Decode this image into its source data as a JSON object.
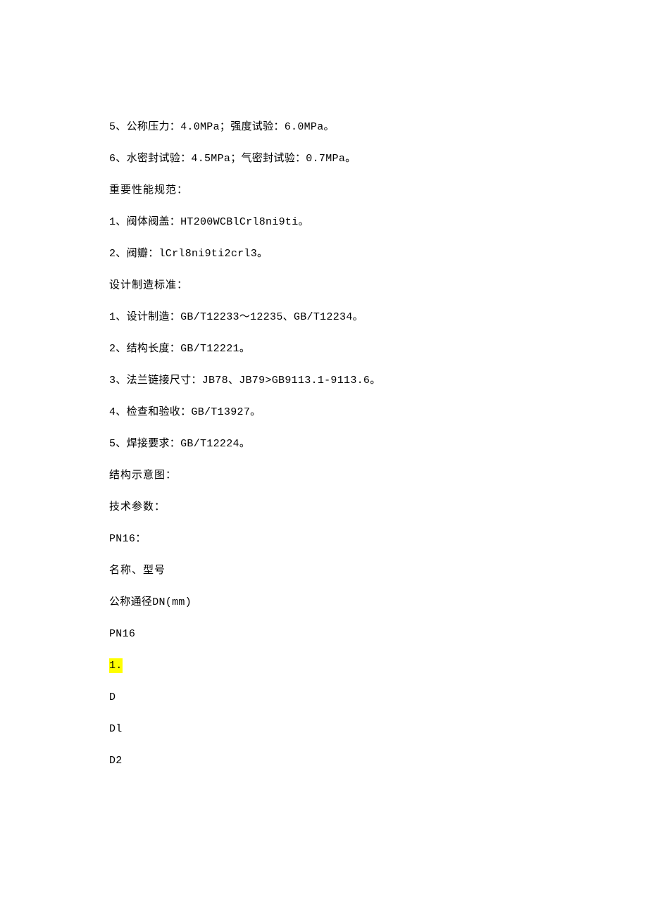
{
  "doc": {
    "l1": "5、公称压力：4.0MPa；强度试验：6.0MPa。",
    "l2": "6、水密封试验：4.5MPa；气密封试验：0.7MPa。",
    "l3": "重要性能规范：",
    "l4": "1、阀体阀盖：HT200WCBlCrl8ni9ti。",
    "l5": "2、阀瓣：lCrl8ni9ti2crl3。",
    "l6": "设计制造标准：",
    "l7": "1、设计制造：GB/T12233～12235、GB/T12234。",
    "l8": "2、结构长度：GB/T12221。",
    "l9": "3、法兰链接尺寸：JB78、JB79>GB9113.1-9113.6。",
    "l10": "4、检查和验收：GB/T13927。",
    "l11": "5、焊接要求：GB/T12224。",
    "l12": "结构示意图：",
    "l13": "技术参数：",
    "l14": "PN16：",
    "l15": "名称、型号",
    "l16": "公称通径DN(mm)",
    "l17": "PN16",
    "l18": "1.",
    "l19": "D",
    "l20": "Dl",
    "l21": "D2"
  }
}
